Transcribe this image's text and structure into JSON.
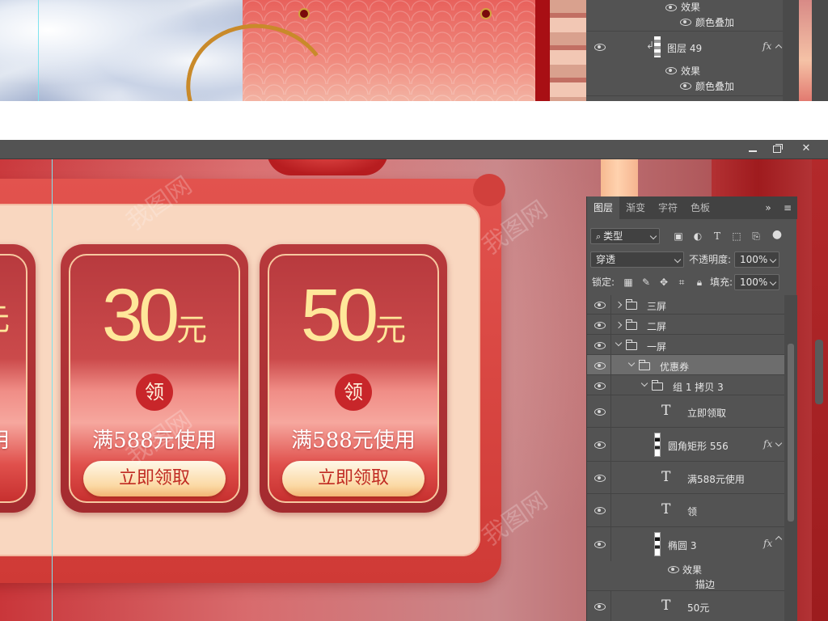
{
  "top_panel": {
    "rows": [
      {
        "label": "效果",
        "kind": "effect-group"
      },
      {
        "label": "颜色叠加",
        "kind": "effect"
      },
      {
        "label": "图层 49",
        "kind": "layer",
        "fx": "fx"
      },
      {
        "label": "效果",
        "kind": "effect-group"
      },
      {
        "label": "颜色叠加",
        "kind": "effect"
      }
    ]
  },
  "window": {
    "minimize": "",
    "maximize": "",
    "close": "✕"
  },
  "canvas": {
    "coupons": [
      {
        "amount": "30",
        "unit": "元",
        "badge": "领",
        "condition": "满588元使用",
        "button": "立即领取"
      },
      {
        "amount": "50",
        "unit": "元",
        "badge": "领",
        "condition": "满588元使用",
        "button": "立即领取"
      }
    ],
    "partial_coupon": {
      "unit": "元",
      "condition_tail": "用"
    }
  },
  "layers_panel": {
    "tabs": [
      "图层",
      "渐变",
      "字符",
      "色板"
    ],
    "active_tab": "图层",
    "filter_kind": "类型",
    "blend_mode": "穿透",
    "opacity_label": "不透明度:",
    "opacity_value": "100%",
    "lock_label": "锁定:",
    "fill_label": "填充:",
    "fill_value": "100%",
    "layers": [
      {
        "label": "三屏",
        "type": "group",
        "expanded": false
      },
      {
        "label": "二屏",
        "type": "group",
        "expanded": false
      },
      {
        "label": "一屏",
        "type": "group",
        "expanded": true
      },
      {
        "label": "优惠券",
        "type": "group",
        "expanded": true,
        "selected": true
      },
      {
        "label": "组 1 拷贝 3",
        "type": "group",
        "expanded": true
      },
      {
        "label": "立即领取",
        "type": "text"
      },
      {
        "label": "圆角矩形 556",
        "type": "shape",
        "fx": "fx"
      },
      {
        "label": "满588元使用",
        "type": "text"
      },
      {
        "label": "领",
        "type": "text"
      },
      {
        "label": "椭圆 3",
        "type": "shape",
        "fx": "fx"
      },
      {
        "label": "效果",
        "type": "effect-group"
      },
      {
        "label": "描边",
        "type": "effect"
      },
      {
        "label": "50元",
        "type": "text"
      }
    ]
  },
  "watermark_text": "我图网",
  "colors": {
    "panel_bg": "#535353",
    "coupon_amount": "#ffe79a",
    "coupon_red": "#c8262a",
    "guide": "#7fe3ee"
  }
}
